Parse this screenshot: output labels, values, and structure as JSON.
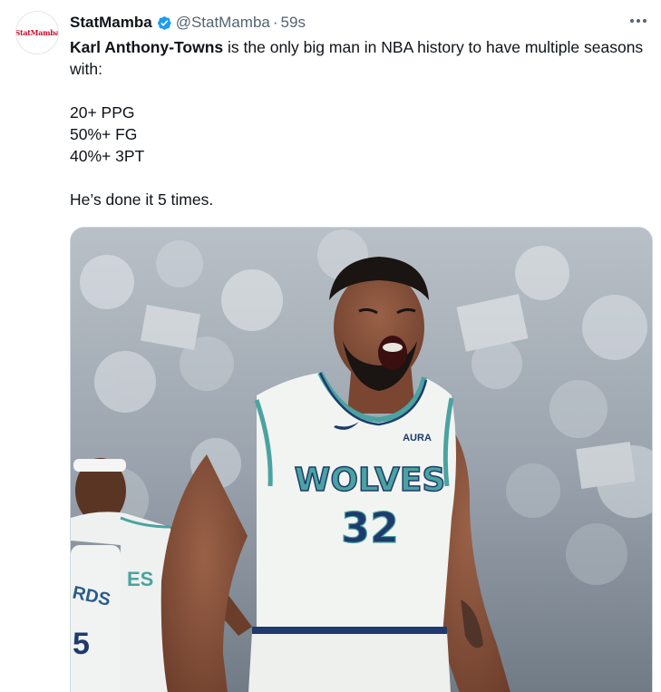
{
  "tweet": {
    "author": {
      "display_name": "StatMamba",
      "handle": "@StatMamba",
      "avatar_text": "StatMamba",
      "verified": true
    },
    "separator": "·",
    "timestamp": "59s",
    "more_icon": "ellipsis-icon",
    "text": {
      "highlight": "Karl Anthony-Towns",
      "line1_rest": " is the only big man in NBA history to have multiple seasons with:",
      "stats": [
        "20+ PPG",
        "50%+ FG",
        "40%+ 3PT"
      ],
      "closing": "He’s done it 5 times."
    },
    "media": {
      "jersey_team": "WOLVES",
      "jersey_number": "32",
      "jersey_sponsor": "AURA",
      "left_player_jersey_partial": "ES",
      "far_left_jersey_partial": "RDS",
      "far_left_number_partial": "5"
    }
  },
  "colors": {
    "verified_blue": "#1d9bf0",
    "text_primary": "#0f1419",
    "text_secondary": "#536471",
    "jersey_white": "#f2f4f1",
    "jersey_navy": "#1e3a6e",
    "jersey_teal": "#4aa3a0",
    "avatar_red": "#c8102e"
  }
}
